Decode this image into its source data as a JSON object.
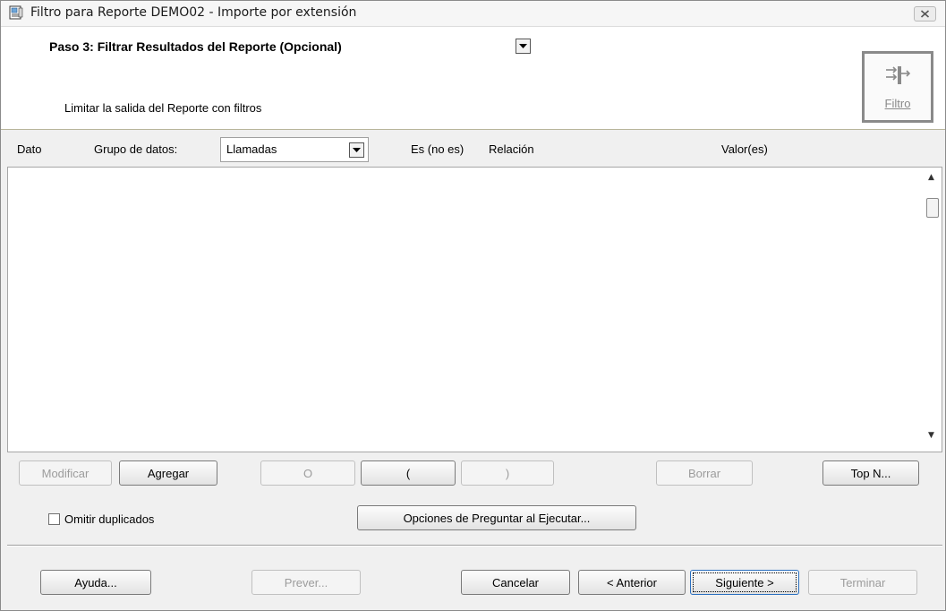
{
  "window": {
    "title": "Filtro para Reporte DEMO02 - Importe por extensión"
  },
  "header": {
    "step_label": "Paso 3: Filtrar Resultados del Reporte (Opcional)",
    "step_description": "Limitar la salida del Reporte con filtros",
    "filter_button_label": "Filtro"
  },
  "columns": {
    "dato": "Dato",
    "grupo_label": "Grupo de datos:",
    "grupo_value": "Llamadas",
    "es_no_es": "Es (no es)",
    "relacion": "Relación",
    "valores": "Valor(es)"
  },
  "filter_buttons": {
    "modificar": "Modificar",
    "agregar": "Agregar",
    "o": "O",
    "open_paren": "(",
    "close_paren": ")",
    "borrar": "Borrar",
    "top_n": "Top N..."
  },
  "options": {
    "omitir_duplicados": "Omitir duplicados",
    "omitir_duplicados_checked": false,
    "preguntar": "Opciones de Preguntar al Ejecutar..."
  },
  "footer": {
    "ayuda": "Ayuda...",
    "prever": "Prever...",
    "cancelar": "Cancelar",
    "anterior": "< Anterior",
    "siguiente": "Siguiente >",
    "terminar": "Terminar"
  },
  "icons": {
    "window": "report-window-icon",
    "close": "close-icon",
    "filter": "filter-icon",
    "dropdown": "chevron-down-icon"
  }
}
